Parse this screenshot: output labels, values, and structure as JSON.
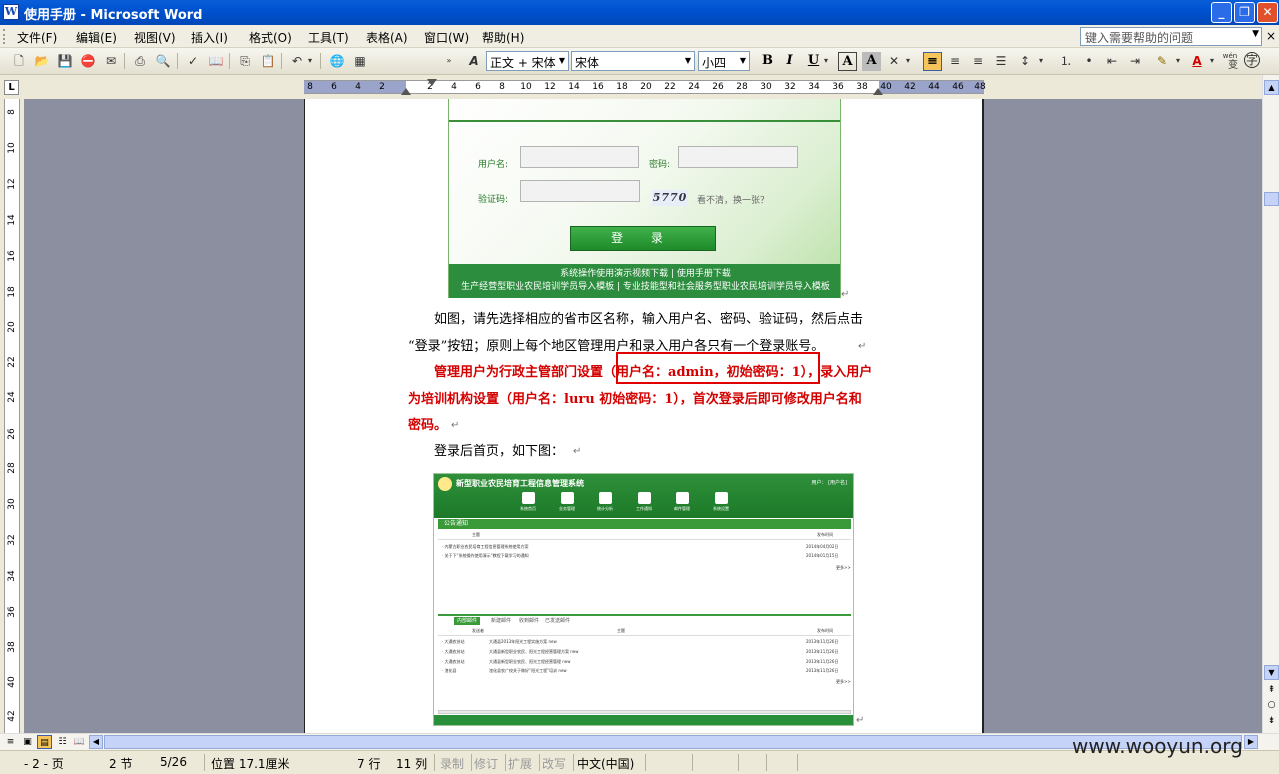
{
  "window": {
    "title": "使用手册 - Microsoft Word",
    "app_icon": "word-icon"
  },
  "menu": {
    "items": [
      "文件(F)",
      "编辑(E)",
      "视图(V)",
      "插入(I)",
      "格式(O)",
      "工具(T)",
      "表格(A)",
      "窗口(W)",
      "帮助(H)"
    ],
    "help_placeholder": "键入需要帮助的问题"
  },
  "toolbar": {
    "style": "正文 + 宋体",
    "font": "宋体",
    "size": "小四",
    "bold": "B",
    "italic": "I",
    "underline": "U",
    "char_border": "A",
    "char_shading": "A",
    "font_color": "A",
    "phonetic": "变",
    "enclose": "字",
    "wen": "wén"
  },
  "ruler": {
    "h_ticks": [
      "8",
      "6",
      "4",
      "2",
      "2",
      "4",
      "6",
      "8",
      "10",
      "12",
      "14",
      "16",
      "18",
      "20",
      "22",
      "24",
      "26",
      "28",
      "30",
      "32",
      "34",
      "36",
      "38",
      "40",
      "42",
      "44",
      "46",
      "48"
    ],
    "v_ticks": [
      "8",
      "10",
      "12",
      "14",
      "16",
      "18",
      "20",
      "22",
      "24",
      "26",
      "28",
      "30",
      "32",
      "34",
      "36",
      "38",
      "40",
      "42"
    ],
    "tab_selector": "L"
  },
  "document": {
    "login_image": {
      "username_label": "用户名:",
      "password_label": "密码:",
      "captcha_label": "验证码:",
      "captcha_value": "5770",
      "refresh_text": "看不清，换一张？",
      "login_button": "登 录",
      "footer_line1": "系统操作使用演示视频下载 | 使用手册下载",
      "footer_line2": "生产经营型职业农民培训学员导入模板 | 专业技能型和社会服务型职业农民培训学员导入模板"
    },
    "para1_line1": "如图，请先选择相应的省市区名称，输入用户名、密码、验证码，然后点击",
    "para1_line2": "“登录”按钮；原则上每个地区管理用户和录入用户各只有一个登录账号。",
    "para2_line1_a": "管理用户为行政主管部门设置",
    "para2_line1_b": "（用户名：admin，初始密码：1），",
    "para2_line1_c": "录入用户",
    "para2_line2": "为培训机构设置（用户名：luru 初始密码：1），首次登录后即可修改用户名和",
    "para2_line3": "密码。",
    "para3": "登录后首页，如下图：",
    "para_mark": "↵",
    "home_image": {
      "system_name": "新型职业农民培育工程信息管理系统",
      "user_info": "用户：  [用户名]",
      "nav": [
        "系统首页",
        "业务管理",
        "统计分析",
        "工作通知",
        "邮件管理",
        "系统设置"
      ],
      "notice_title": "公告通知",
      "col_subject": "主题",
      "col_time": "发布时间",
      "notices": [
        {
          "title": "· 内蒙古职业农民培育工程信息管理系统使用方案",
          "time": "2014年04月02日"
        },
        {
          "title": "· 关于下“系统操作使用演示”教程下载学习的通知",
          "time": "2014年01月15日"
        }
      ],
      "more": "更多>>",
      "mail_tabs": [
        "内部邮件",
        "新建邮件",
        "收到邮件",
        "已发送邮件"
      ],
      "col_sender": "发送者",
      "mails": [
        {
          "sender": "· 大通农技站",
          "subject": "大通县2013年阳光工程实施方案 new",
          "time": "2013年11月26日"
        },
        {
          "sender": "· 大通农技站",
          "subject": "大通县新型职业农民、阳光工程经营管理方案 new",
          "time": "2013年11月26日"
        },
        {
          "sender": "· 大通农技站",
          "subject": "大通县新型职业农民、阳光工程经营管理 new",
          "time": "2013年11月26日"
        },
        {
          "sender": "· 湟化县",
          "subject": "湟化县农广校关于做好“阳光工程”培训 new",
          "time": "2013年11月26日"
        }
      ]
    }
  },
  "status": {
    "page": "- 2 - 页",
    "section": "2 节",
    "page_count": "5/26",
    "position": "位置 17.1厘米",
    "line": "7 行",
    "column": "11 列",
    "rec": "录制",
    "trk": "修订",
    "ext": "扩展",
    "ovr": "改写",
    "language": "中文(中国)"
  },
  "watermark": "www.wooyun.org"
}
